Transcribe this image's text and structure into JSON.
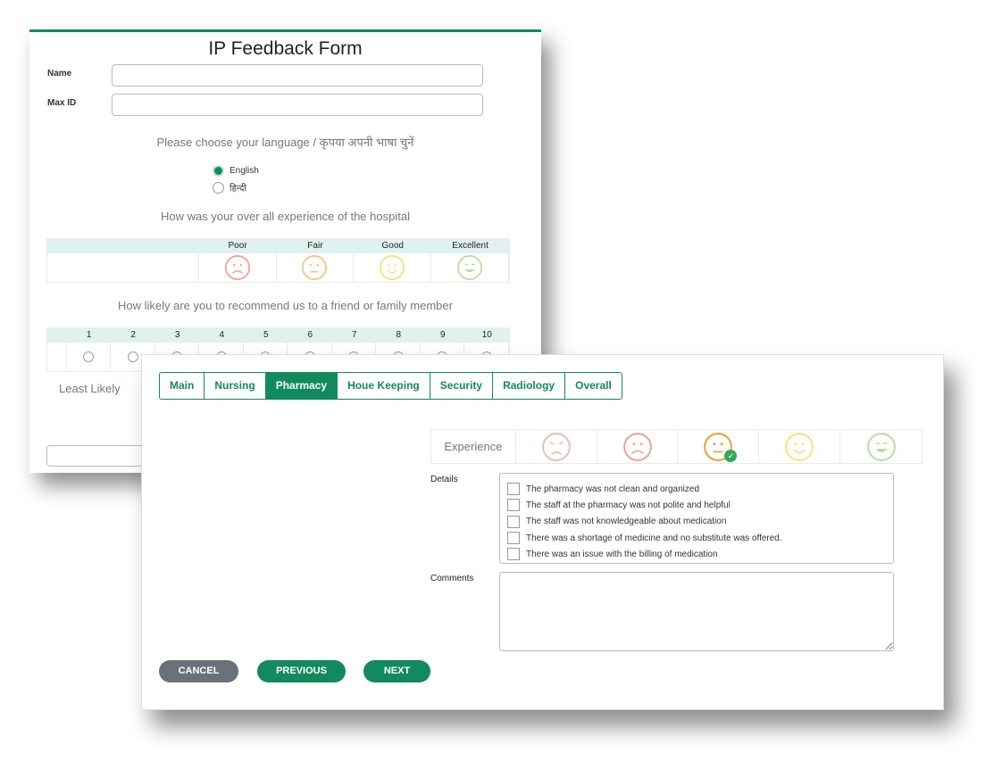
{
  "back_form": {
    "title": "IP Feedback Form",
    "name_label": "Name",
    "name_value": "",
    "maxid_label": "Max ID",
    "maxid_value": "",
    "language_prompt": "Please choose your language / कृपया अपनी भाषा चुनें",
    "languages": [
      {
        "label": "English",
        "selected": true
      },
      {
        "label": "हिन्दी",
        "selected": false
      }
    ],
    "experience_question": "How was your over all experience of the hospital",
    "experience_columns": [
      {
        "label": "Poor",
        "icon": "sad-face-icon",
        "color": "#f0a090"
      },
      {
        "label": "Fair",
        "icon": "neutral-face-icon",
        "color": "#f5c27a"
      },
      {
        "label": "Good",
        "icon": "smile-face-icon",
        "color": "#f5e07a"
      },
      {
        "label": "Excellent",
        "icon": "grin-face-icon",
        "color": "#b9dd9a"
      }
    ],
    "recommend_question": "How likely are you to recommend us to a friend or family member",
    "scale": [
      "1",
      "2",
      "3",
      "4",
      "5",
      "6",
      "7",
      "8",
      "9",
      "10"
    ],
    "least_likely": "Least Likely"
  },
  "front_form": {
    "tabs": [
      {
        "label": "Main"
      },
      {
        "label": "Nursing"
      },
      {
        "label": "Pharmacy",
        "active": true
      },
      {
        "label": "Houe Keeping"
      },
      {
        "label": "Security"
      },
      {
        "label": "Radiology"
      },
      {
        "label": "Overall"
      }
    ],
    "experience_label": "Experience",
    "experience_faces": [
      {
        "icon": "angry-face-icon",
        "color": "#f3b8ad",
        "selected": false
      },
      {
        "icon": "sad-face-icon",
        "color": "#f0a090",
        "selected": false
      },
      {
        "icon": "neutral-face-icon",
        "color": "#ef9a2d",
        "selected": true
      },
      {
        "icon": "smile-face-icon",
        "color": "#f5e07a",
        "selected": false
      },
      {
        "icon": "grin-face-icon",
        "color": "#b9dd9a",
        "selected": false
      }
    ],
    "details_label": "Details",
    "details": [
      {
        "label": "The pharmacy was not clean and organized",
        "checked": false
      },
      {
        "label": "The staff at the pharmacy was not polite and helpful",
        "checked": false
      },
      {
        "label": "The staff was not knowledgeable about medication",
        "checked": false
      },
      {
        "label": "There was a shortage of medicine and no substitute was offered.",
        "checked": false
      },
      {
        "label": "There was an issue with the billing of medication",
        "checked": false
      }
    ],
    "comments_label": "Comments",
    "comments_value": "",
    "buttons": {
      "cancel": "CANCEL",
      "previous": "PREVIOUS",
      "next": "NEXT"
    }
  },
  "colors": {
    "accent": "#118a5e",
    "cancel": "#6b717a",
    "header_bg": "#dff2f0"
  }
}
